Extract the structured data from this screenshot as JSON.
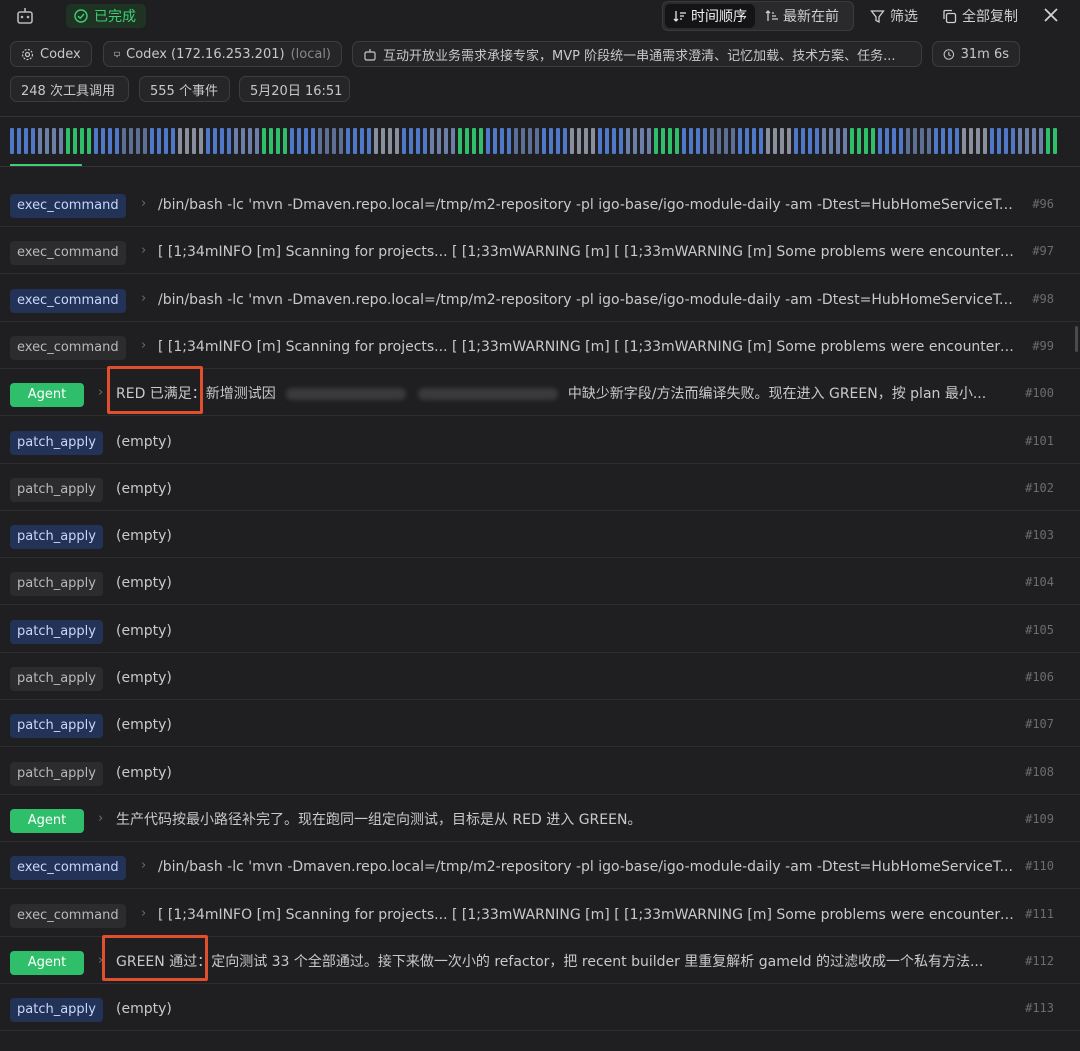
{
  "header": {
    "status": "已完成",
    "sort_chronological": "时间顺序",
    "sort_newest": "最新在前",
    "filter": "筛选",
    "copy_all": "全部复制",
    "accent": "#3ecf72"
  },
  "chips": {
    "agent": "Codex",
    "host_name": "Codex (172.16.253.201)",
    "host_tag": "(local)",
    "task": "互动开放业务需求承接专家，MVP 阶段统一串通需求澄清、记忆加载、技术方案、任务...",
    "duration": "31m 6s",
    "tool_calls": "248 次工具调用",
    "events": "555 个事件",
    "date": "5月20日 16:51"
  },
  "rows": [
    {
      "tag": "exec_command",
      "style": "exec-blue",
      "text": "/bin/bash -lc 'mvn -Dmaven.repo.local=/tmp/m2-repository -pl igo-base/igo-module-daily -am -Dtest=HubHomeServiceTe...",
      "num": "#96"
    },
    {
      "tag": "exec_command",
      "style": "exec-gray",
      "text": "[ [1;34mINFO [m] Scanning for projects... [ [1;33mWARNING [m] [ [1;33mWARNING [m] Some problems were encountered...",
      "num": "#97"
    },
    {
      "tag": "exec_command",
      "style": "exec-blue",
      "text": "/bin/bash -lc 'mvn -Dmaven.repo.local=/tmp/m2-repository -pl igo-base/igo-module-daily -am -Dtest=HubHomeServiceTe...",
      "num": "#98"
    },
    {
      "tag": "exec_command",
      "style": "exec-gray",
      "text": "[ [1;34mINFO [m] Scanning for projects... [ [1;33mWARNING [m] [ [1;33mWARNING [m] Some problems were encountered...",
      "num": "#99"
    },
    {
      "tag": "Agent",
      "style": "agent",
      "text_a": "RED 已满足：新增测试因",
      "text_b": "中缺少新字段/方法而编译失败。现在进入 GREEN，按 plan 最小...",
      "num": "#100"
    },
    {
      "tag": "patch_apply",
      "style": "exec-blue",
      "text": "(empty)",
      "num": "#101"
    },
    {
      "tag": "patch_apply",
      "style": "exec-gray",
      "text": "(empty)",
      "num": "#102"
    },
    {
      "tag": "patch_apply",
      "style": "exec-blue",
      "text": "(empty)",
      "num": "#103"
    },
    {
      "tag": "patch_apply",
      "style": "exec-gray",
      "text": "(empty)",
      "num": "#104"
    },
    {
      "tag": "patch_apply",
      "style": "exec-blue",
      "text": "(empty)",
      "num": "#105"
    },
    {
      "tag": "patch_apply",
      "style": "exec-gray",
      "text": "(empty)",
      "num": "#106"
    },
    {
      "tag": "patch_apply",
      "style": "exec-blue",
      "text": "(empty)",
      "num": "#107"
    },
    {
      "tag": "patch_apply",
      "style": "exec-gray",
      "text": "(empty)",
      "num": "#108"
    },
    {
      "tag": "Agent",
      "style": "agent",
      "text": "生产代码按最小路径补完了。现在跑同一组定向测试，目标是从 RED 进入 GREEN。",
      "num": "#109"
    },
    {
      "tag": "exec_command",
      "style": "exec-blue",
      "text": "/bin/bash -lc 'mvn -Dmaven.repo.local=/tmp/m2-repository -pl igo-base/igo-module-daily -am -Dtest=HubHomeServiceT...",
      "num": "#110"
    },
    {
      "tag": "exec_command",
      "style": "exec-gray",
      "text": "[ [1;34mINFO [m] Scanning for projects... [ [1;33mWARNING [m] [ [1;33mWARNING [m] Some problems were encountere...",
      "num": "#111"
    },
    {
      "tag": "Agent",
      "style": "agent",
      "text": "GREEN 通过：定向测试 33 个全部通过。接下来做一次小的 refactor，把 recent builder 里重复解析 gameId 的过滤收成一个私有方法...",
      "num": "#112"
    },
    {
      "tag": "patch_apply",
      "style": "exec-blue",
      "text": "(empty)",
      "num": "#113"
    }
  ]
}
